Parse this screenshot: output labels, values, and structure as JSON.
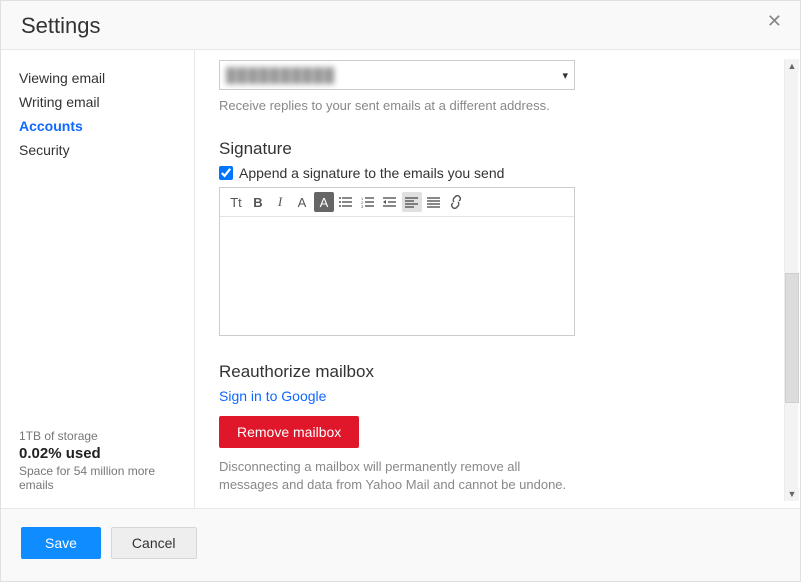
{
  "header": {
    "title": "Settings"
  },
  "nav": {
    "items": [
      {
        "label": "Viewing email"
      },
      {
        "label": "Writing email"
      },
      {
        "label": "Accounts"
      },
      {
        "label": "Security"
      }
    ],
    "active_index": 2
  },
  "storage": {
    "line1": "1TB of storage",
    "line2": "0.02% used",
    "line3": "Space for 54 million more emails"
  },
  "reply": {
    "selected_blurred": "██████████",
    "helper": "Receive replies to your sent emails at a different address."
  },
  "signature": {
    "title": "Signature",
    "checkbox_label": "Append a signature to the emails you send",
    "checked": true,
    "toolbar": {
      "font_size": "Tt",
      "bold": "B",
      "italic": "I",
      "font_color": "A",
      "highlight": "A",
      "bullets": "≡",
      "numbers": "≡",
      "outdent": "⇤",
      "align": "≡",
      "justify": "≡",
      "link": "🔗"
    }
  },
  "reauth": {
    "title": "Reauthorize mailbox",
    "link": "Sign in to Google",
    "remove_button": "Remove mailbox",
    "desc": "Disconnecting a mailbox will permanently remove all messages and data from Yahoo Mail and cannot be undone."
  },
  "footer": {
    "save": "Save",
    "cancel": "Cancel"
  },
  "close": "✕"
}
